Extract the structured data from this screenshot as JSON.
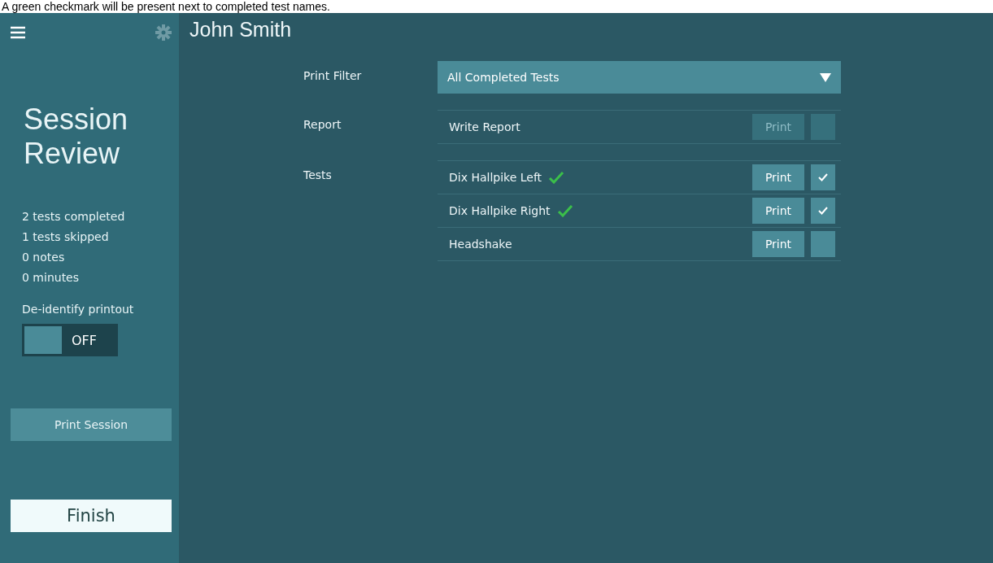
{
  "caption": "A green checkmark will be present next to completed test names.",
  "sidebar": {
    "title_lines": [
      "Session",
      "Review"
    ],
    "stats": [
      "2 tests completed",
      "1 tests skipped",
      "0 notes",
      "0 minutes"
    ],
    "deidentify": {
      "label": "De-identify printout",
      "on": false,
      "state_text": "OFF"
    },
    "print_button": "Print Session",
    "finish_button": "Finish"
  },
  "patient_name": "John Smith",
  "print_filter": {
    "label": "Print Filter",
    "value": "All Completed Tests"
  },
  "report": {
    "label": "Report",
    "items": [
      {
        "name": "Write Report",
        "completed": false,
        "print": "Print",
        "disabled": true,
        "checked": false
      }
    ]
  },
  "tests": {
    "label": "Tests",
    "items": [
      {
        "name": "Dix Hallpike Left",
        "completed": true,
        "print": "Print",
        "disabled": false,
        "checked": true
      },
      {
        "name": "Dix Hallpike Right",
        "completed": true,
        "print": "Print",
        "disabled": false,
        "checked": true
      },
      {
        "name": "Headshake",
        "completed": false,
        "print": "Print",
        "disabled": false,
        "checked": false
      }
    ]
  }
}
